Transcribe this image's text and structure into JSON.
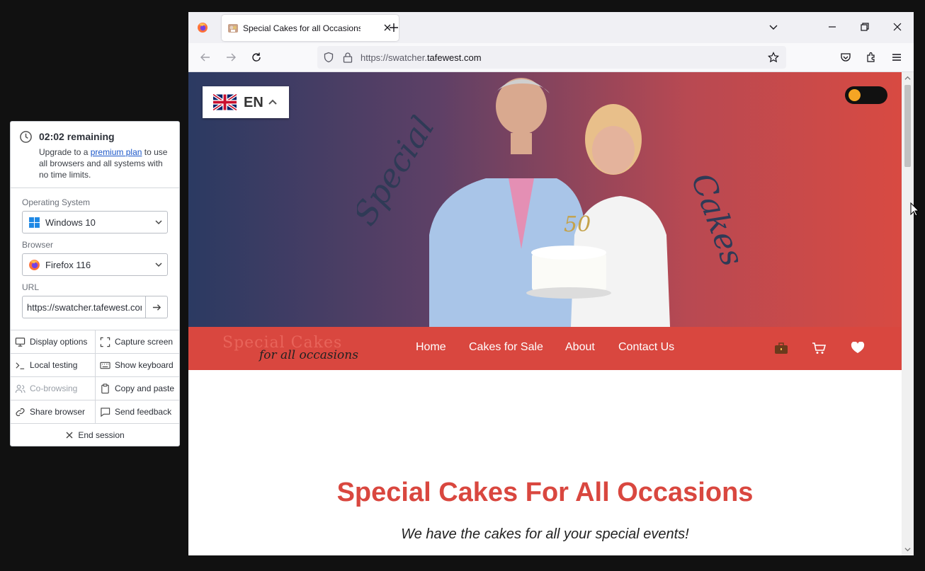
{
  "session": {
    "timer": "02:02 remaining",
    "upgrade_prefix": "Upgrade to a ",
    "upgrade_link": "premium plan",
    "upgrade_suffix": " to use all browsers and all systems with no time limits.",
    "os_label": "Operating System",
    "os_value": "Windows 10",
    "browser_label": "Browser",
    "browser_value": "Firefox 116",
    "url_label": "URL",
    "url_value": "https://swatcher.tafewest.com",
    "actions": [
      {
        "label": "Display options",
        "icon": "monitor-icon"
      },
      {
        "label": "Capture screen",
        "icon": "capture-icon"
      },
      {
        "label": "Local testing",
        "icon": "terminal-icon"
      },
      {
        "label": "Show keyboard",
        "icon": "keyboard-icon"
      },
      {
        "label": "Co-browsing",
        "icon": "users-icon"
      },
      {
        "label": "Copy and paste",
        "icon": "clipboard-icon"
      },
      {
        "label": "Share browser",
        "icon": "link-icon"
      },
      {
        "label": "Send feedback",
        "icon": "feedback-icon"
      }
    ],
    "end_label": "End session"
  },
  "browser": {
    "tab_title": "Special Cakes for all Occasions",
    "url_host_prefix": "https://swatcher.",
    "url_host_domain": "tafewest.com"
  },
  "site": {
    "language": "EN",
    "hero_word_left": "Special",
    "hero_word_right": "Cakes",
    "logo_line1": "Special Cakes",
    "logo_line2": "for all occasions",
    "nav": [
      "Home",
      "Cakes for Sale",
      "About",
      "Contact Us"
    ],
    "headline": "Special Cakes For All Occasions",
    "subline": "We have the cakes for all your special events!",
    "colors": {
      "brand_red": "#d9473f",
      "toggle_knob": "#f5a524"
    }
  }
}
